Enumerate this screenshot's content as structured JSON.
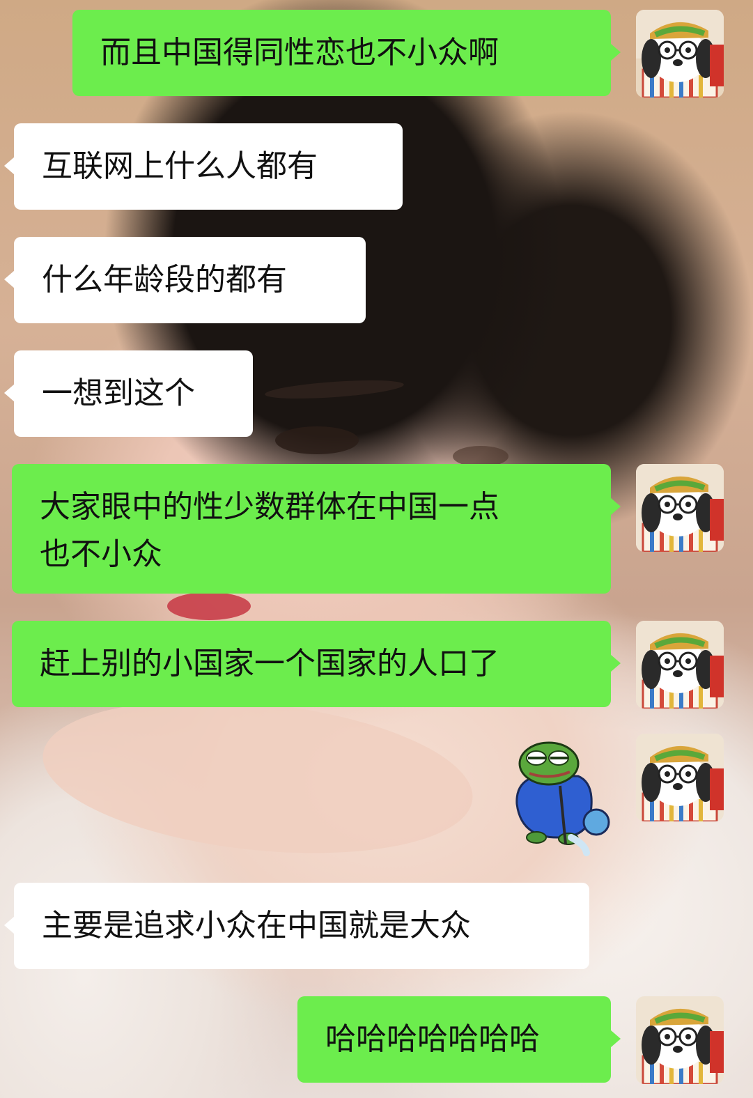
{
  "messages": [
    {
      "id": 1,
      "side": "right",
      "text": "而且中国得同性恋也不小众啊"
    },
    {
      "id": 2,
      "side": "left",
      "text": "互联网上什么人都有"
    },
    {
      "id": 3,
      "side": "left",
      "text": "什么年龄段的都有"
    },
    {
      "id": 4,
      "side": "left",
      "text": "一想到这个"
    },
    {
      "id": 5,
      "side": "right",
      "line1": "大家眼中的性少数群体在中国一点",
      "line2": "也不小众"
    },
    {
      "id": 6,
      "side": "right",
      "text": "赶上别的小国家一个国家的人口了"
    },
    {
      "id": 7,
      "side": "right",
      "sticker": "pepe-frog-sticker"
    },
    {
      "id": 8,
      "side": "left",
      "text": "主要是追求小众在中国就是大众"
    },
    {
      "id": 9,
      "side": "right",
      "text": "哈哈哈哈哈哈哈"
    }
  ],
  "colors": {
    "sent_bubble": "#6ced4d",
    "received_bubble": "#ffffff",
    "text": "#111111"
  },
  "icons": {
    "self_avatar": "cartoon-dog-avatar",
    "sticker": "pepe-frog-sticker"
  }
}
